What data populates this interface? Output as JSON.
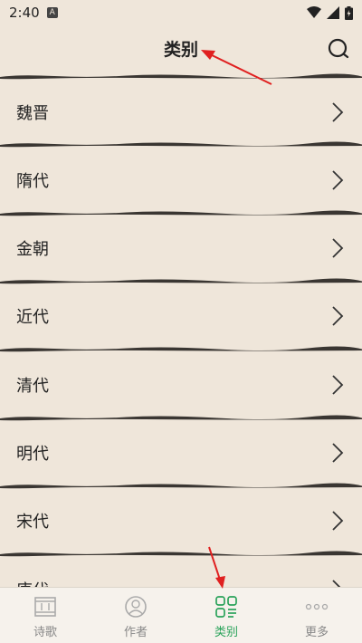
{
  "status": {
    "time": "2:40",
    "notif": "A"
  },
  "header": {
    "title": "类别"
  },
  "categories": [
    {
      "label": "魏晋"
    },
    {
      "label": "隋代"
    },
    {
      "label": "金朝"
    },
    {
      "label": "近代"
    },
    {
      "label": "清代"
    },
    {
      "label": "明代"
    },
    {
      "label": "宋代"
    },
    {
      "label": "唐代"
    }
  ],
  "nav": {
    "items": [
      {
        "label": "诗歌",
        "icon": "poem-icon"
      },
      {
        "label": "作者",
        "icon": "author-icon"
      },
      {
        "label": "类别",
        "icon": "category-icon",
        "active": true
      },
      {
        "label": "更多",
        "icon": "more-icon"
      }
    ]
  },
  "colors": {
    "background": "#efe6da",
    "accent": "#2aa35a",
    "annotation": "#e02020"
  }
}
